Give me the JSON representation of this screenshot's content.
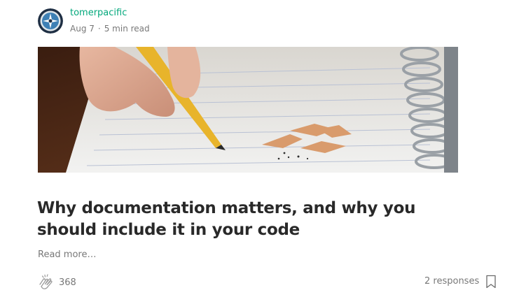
{
  "author": {
    "name": "tomerpacific",
    "date": "Aug 7",
    "separator": "·",
    "read_time": "5 min read"
  },
  "post": {
    "title": "Why documentation matters, and why you should include it in your code",
    "read_more": "Read more…",
    "claps": "368",
    "responses": "2 responses"
  },
  "icons": {
    "avatar": "compass-logo-avatar",
    "clap": "clap-icon",
    "bookmark": "bookmark-icon"
  },
  "colors": {
    "author_link": "#03a87c",
    "muted_text": "rgba(0,0,0,0.54)",
    "title_text": "rgba(0,0,0,0.84)"
  }
}
